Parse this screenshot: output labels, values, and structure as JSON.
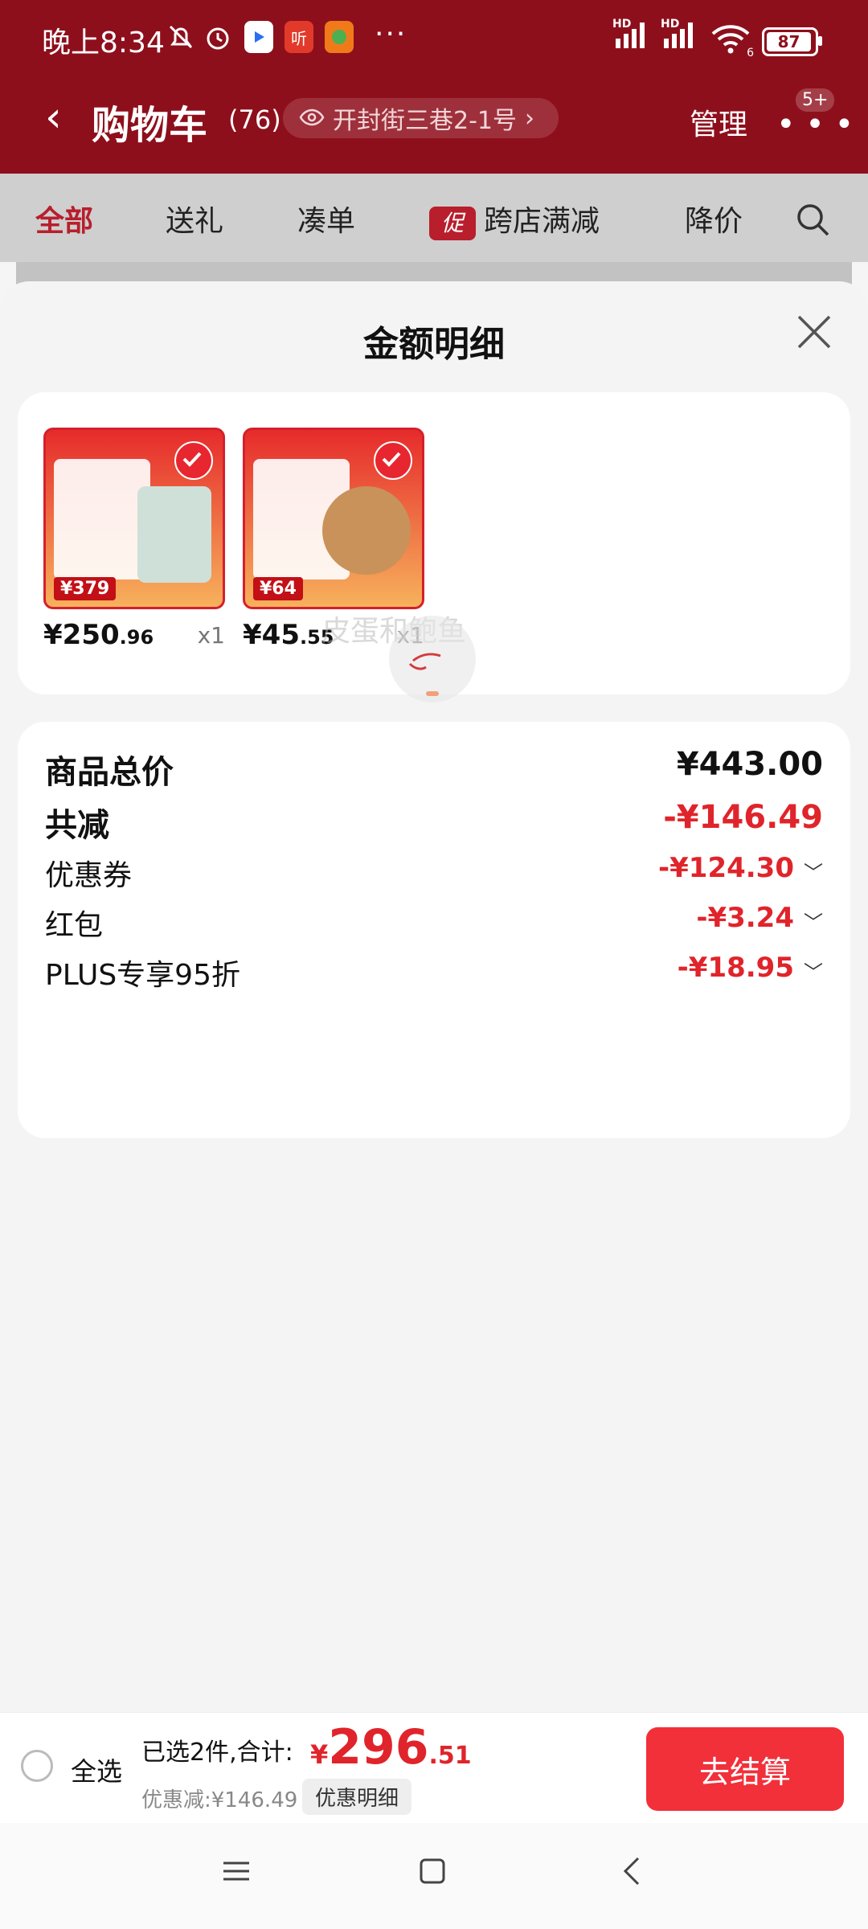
{
  "status": {
    "time": "晚上8:34",
    "app_icon_text": "听",
    "overflow": "···",
    "sig1_label": "HD",
    "sig2_label": "HD",
    "wifi_label": "6",
    "battery": "87"
  },
  "header": {
    "back_label": "‹",
    "title": "购物车",
    "count": "(76)",
    "address": "开封街三巷2-1号",
    "address_chevron": "›",
    "manage": "管理",
    "more_dots": "• • •",
    "badge": "5+"
  },
  "tabs": {
    "all": "全部",
    "gift": "送礼",
    "bundle": "凑单",
    "promo_badge": "促",
    "cross_store": "跨店满减",
    "price_drop": "降价"
  },
  "sheet": {
    "title": "金额明细",
    "products": [
      {
        "price_int": "¥250",
        "price_dec": ".96",
        "qty": "x1",
        "tag": "¥379"
      },
      {
        "price_int": "¥45",
        "price_dec": ".55",
        "qty": "x1",
        "tag": "¥64"
      }
    ],
    "summary": {
      "total_label": "商品总价",
      "total_value": "¥443.00",
      "reduce_label": "共减",
      "reduce_value": "-¥146.49",
      "coupon_label": "优惠券",
      "coupon_value": "-¥124.30",
      "redpacket_label": "红包",
      "redpacket_value": "-¥3.24",
      "plus_label": "PLUS专享95折",
      "plus_value": "-¥18.95",
      "chevron": "﹀"
    },
    "watermark": "皮蛋和鲍鱼"
  },
  "bottom": {
    "select_all": "全选",
    "selected_info": "已选2件,合计:",
    "total_symbol": "¥",
    "total_int": "296",
    "total_dec": ".51",
    "discount": "优惠减:¥146.49",
    "detail_button": "优惠明细",
    "checkout": "去结算"
  },
  "colors": {
    "header_red": "#8e0f1c",
    "accent_red": "#e0242b",
    "checkout_red": "#f2303a"
  }
}
